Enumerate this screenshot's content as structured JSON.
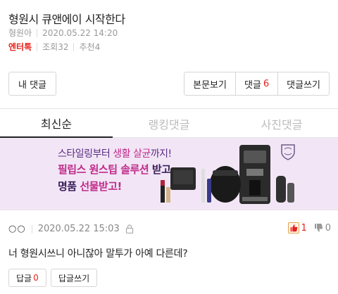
{
  "post": {
    "title": "형원시 큐앤에이 시작한다",
    "author": "형원아",
    "datetime": "2020.05.22 14:20",
    "category": "엔터톡",
    "views": "조회32",
    "recommends": "추천4"
  },
  "actions": {
    "my_comments": "내 댓글",
    "view_body": "본문보기",
    "comments_label": "댓글",
    "comments_count": "6",
    "write_comment": "댓글쓰기"
  },
  "tabs": [
    {
      "label": "최신순"
    },
    {
      "label": "랭킹댓글"
    },
    {
      "label": "사진댓글"
    }
  ],
  "ad": {
    "line1_a": "스타일링부터 ",
    "line1_b": "생활 살균",
    "line1_c": "까지!",
    "line2_a": "필립스 원스팁 솔루션",
    "line2_b": " 받고",
    "line3_a": "명품 ",
    "line3_b": "선물받고!",
    "brand_color": "#5b2c83",
    "accent_color": "#c02b8a"
  },
  "comment": {
    "user": "○○",
    "datetime": "2020.05.22 15:03",
    "like_count": "1",
    "dislike_count": "0",
    "text": "너 형원시쓰니 아니잖아 말투가 아예 다른데?",
    "reply_label": "답글",
    "reply_count": "0",
    "write_reply": "답글쓰기"
  },
  "colors": {
    "accent_red": "#e8211b",
    "ad_background": "#f2e6f6"
  }
}
